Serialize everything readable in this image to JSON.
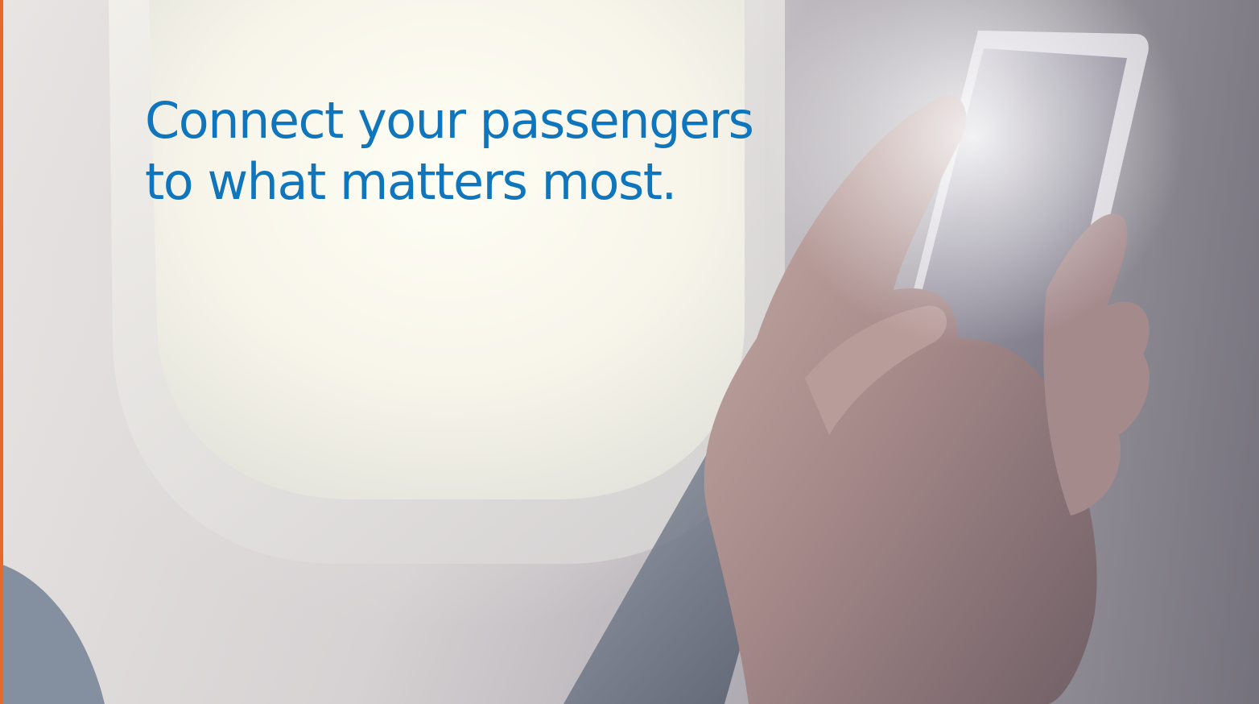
{
  "hero": {
    "headline_line1": "Connect your passengers",
    "headline_line2": "to what matters most."
  },
  "colors": {
    "headline_text": "#0f75bc",
    "accent_strip": "#e8672a"
  },
  "image": {
    "subject": "hand-holding-phone-by-airplane-window"
  }
}
